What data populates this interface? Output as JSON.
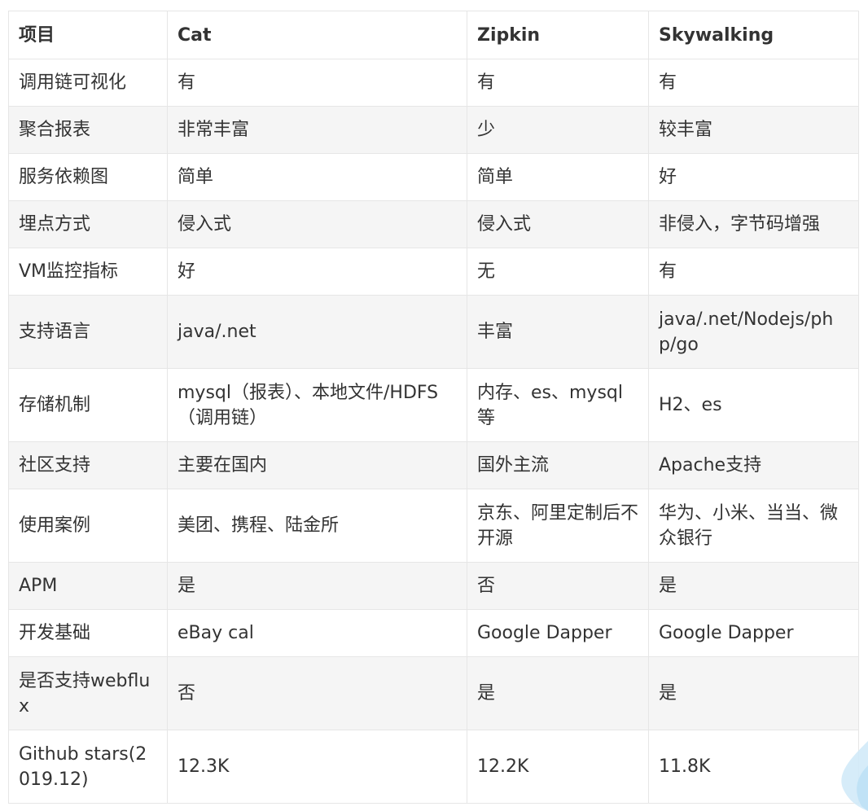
{
  "table": {
    "headers": [
      "项目",
      "Cat",
      "Zipkin",
      "Skywalking"
    ],
    "rows": [
      [
        "调用链可视化",
        "有",
        "有",
        "有"
      ],
      [
        "聚合报表",
        "非常丰富",
        "少",
        "较丰富"
      ],
      [
        "服务依赖图",
        "简单",
        "简单",
        "好"
      ],
      [
        "埋点方式",
        "侵入式",
        "侵入式",
        "非侵入，字节码增强"
      ],
      [
        "VM监控指标",
        "好",
        "无",
        "有"
      ],
      [
        "支持语言",
        "java/.net",
        "丰富",
        "java/.net/Nodejs/php/go"
      ],
      [
        "存储机制",
        "mysql（报表）、本地文件/HDFS（调用链）",
        "内存、es、mysql等",
        "H2、es"
      ],
      [
        "社区支持",
        "主要在国内",
        "国外主流",
        "Apache支持"
      ],
      [
        "使用案例",
        "美团、携程、陆金所",
        "京东、阿里定制后不开源",
        "华为、小米、当当、微众银行"
      ],
      [
        "APM",
        "是",
        "否",
        "是"
      ],
      [
        "开发基础",
        "eBay cal",
        "Google Dapper",
        "Google Dapper"
      ],
      [
        "是否支持webflux",
        "否",
        "是",
        "是"
      ],
      [
        "Github stars(2019.12)",
        "12.3K",
        "12.2K",
        "11.8K"
      ]
    ]
  },
  "colors": {
    "border": "#e6e6e6",
    "stripe": "#f5f5f5",
    "text": "#333333",
    "decoration": "#cfe9f8"
  },
  "decoration": {
    "icon": "corner-wave-icon"
  }
}
